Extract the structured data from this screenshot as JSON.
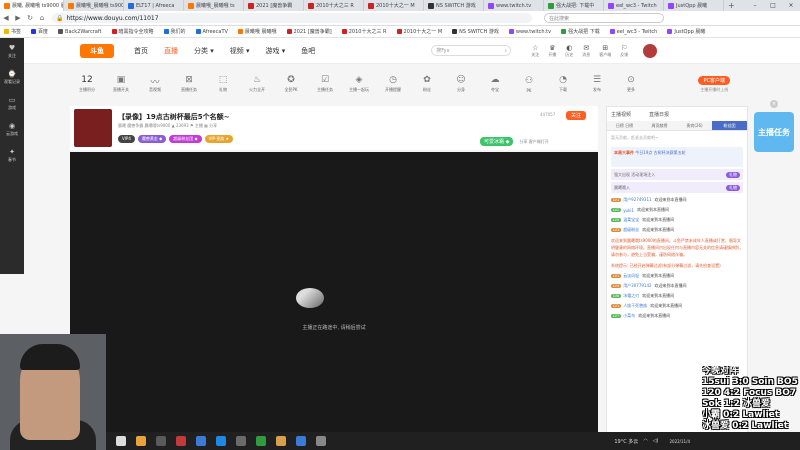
{
  "browser": {
    "tabs": [
      {
        "label": "晨曦, 晨曦哦 ts9000 晨曦哦 11017",
        "color": "#ff7700",
        "active": true
      },
      {
        "label": "晨曦哦_晨曦哦 ts9000",
        "color": "#ff7700"
      },
      {
        "label": "ELT17 | Afreeca",
        "color": "#1e6fd9"
      },
      {
        "label": "晨曦哦_晨曦哦 ts",
        "color": "#ff7700"
      },
      {
        "label": "2021 [魔兽争霸",
        "color": "#c22"
      },
      {
        "label": "2010十大之三 R",
        "color": "#c22"
      },
      {
        "label": "2010十大之一 M",
        "color": "#c22"
      },
      {
        "label": "NS SWITCH 游戏",
        "color": "#333"
      },
      {
        "label": "www.twitch.tv",
        "color": "#9146ff"
      },
      {
        "label": "强大战把: 下载中",
        "color": "#2e9d3b"
      },
      {
        "label": "eel_wc3 - Twitch",
        "color": "#9146ff"
      },
      {
        "label": "JustQpp 晨曦",
        "color": "#9146ff"
      }
    ],
    "new_tab": "+",
    "url": "https://www.douyu.com/11017",
    "search_placeholder": "在此搜索"
  },
  "bookmarks": [
    {
      "label": "书签",
      "color": "#f2b500"
    },
    {
      "label": "百度",
      "color": "#2932e1"
    },
    {
      "label": "Back2Warcraft",
      "color": "#555"
    },
    {
      "label": "暗黑指令全攻略",
      "color": "#c22"
    },
    {
      "label": "我们的",
      "color": "#1e6fd9"
    },
    {
      "label": "AfreecaTV",
      "color": "#1e6fd9"
    },
    {
      "label": "晨曦哦 晨曦哦",
      "color": "#ff7700"
    },
    {
      "label": "2021 [魔兽争霸]",
      "color": "#c22"
    },
    {
      "label": "2010十大之三 R",
      "color": "#c22"
    },
    {
      "label": "2010十大之一 M",
      "color": "#c22"
    },
    {
      "label": "NS SWITCH 游戏",
      "color": "#333"
    },
    {
      "label": "www.twitch.tv",
      "color": "#9146ff"
    },
    {
      "label": "强大战把 下载",
      "color": "#2e9d3b"
    },
    {
      "label": "eel_wc3 - Twitch",
      "color": "#9146ff"
    },
    {
      "label": "JustQpp 晨曦",
      "color": "#9146ff"
    }
  ],
  "sidebar": [
    {
      "icon": "♥",
      "label": "关注"
    },
    {
      "icon": "⌚",
      "label": "观看记录"
    },
    {
      "icon": "▭",
      "label": "游戏"
    },
    {
      "icon": "◉",
      "label": "云游戏"
    },
    {
      "icon": "✦",
      "label": "春节"
    }
  ],
  "site": {
    "logo": "斗鱼",
    "nav": [
      "首页",
      "直播",
      "分类 ▾",
      "视频 ▾",
      "游戏 ▾",
      "鱼吧"
    ],
    "search_placeholder": "搜Fyx",
    "header_icons": [
      {
        "icon": "☆",
        "label": "关注"
      },
      {
        "icon": "♛",
        "label": "开播"
      },
      {
        "icon": "◐",
        "label": "历史"
      },
      {
        "icon": "✉",
        "label": "消息"
      },
      {
        "icon": "⊞",
        "label": "客户端"
      },
      {
        "icon": "⚐",
        "label": "反馈"
      }
    ]
  },
  "toolbar": {
    "level": "12",
    "level_label": "主播积分",
    "items": [
      {
        "icon": "▣",
        "label": "直播开关"
      },
      {
        "icon": "〰",
        "label": "音视频"
      },
      {
        "icon": "⊠",
        "label": "直播任务"
      },
      {
        "icon": "⬚",
        "label": "礼物"
      },
      {
        "icon": "♨",
        "label": "火力全开"
      },
      {
        "icon": "✪",
        "label": "全民PK"
      },
      {
        "icon": "☑",
        "label": "主播任务"
      },
      {
        "icon": "◈",
        "label": "主播一起玩"
      },
      {
        "icon": "◷",
        "label": "开播提醒"
      },
      {
        "icon": "✿",
        "label": "粉丝"
      },
      {
        "icon": "☺",
        "label": "分身"
      },
      {
        "icon": "☁",
        "label": "夺宝"
      },
      {
        "icon": "⚇",
        "label": "PK"
      },
      {
        "icon": "◔",
        "label": "下载"
      },
      {
        "icon": "☰",
        "label": "发布"
      },
      {
        "icon": "⊙",
        "label": "更多"
      }
    ],
    "pc_button": "PC客户端",
    "pc_hint": "主播开播时上线"
  },
  "room": {
    "title": "【录像】19点古树杯最后5个名额~",
    "meta": "晨曦   魔兽争霸   晨曦哦ts9000   ▲ 23693   ⚑ 主播   ▦ 分享",
    "tags": [
      {
        "label": "VIP4",
        "color": "#444"
      },
      {
        "label": "魔兽黄金 ◆",
        "color": "#8a5cd6"
      },
      {
        "label": "超级粉丝团 ◆",
        "color": "#c23bd6"
      },
      {
        "label": "VIP·皇族 ★",
        "color": "#e6a52e"
      }
    ],
    "follow_count": "447057",
    "follow_label": "关注",
    "action_green": "可爱冰霜 ◆",
    "actions": "分享   客户端打开",
    "loading_text": "主播正在路途中, 请稍后尝试"
  },
  "chat": {
    "top_left": "主播视频",
    "top_right": "直播日报",
    "tabs": [
      "日榜 日榜",
      "周贡献榜",
      "贵宾(26)",
      "粉丝团"
    ],
    "rank_empty": "暂无贡献，赶紧去贡献吧~",
    "notice_title": "本周大事件",
    "notice_body": "今日19点 古树杯决赛第五轮",
    "gift1": "强大出现 活动现场注入",
    "gift1_btn": "礼物",
    "gift2": "晨曦哦入",
    "gift2_btn": "礼物",
    "messages": [
      {
        "lv": "LV1",
        "lvcolor": "#e08b3b",
        "nick": "用户92749311",
        "text": "欢迎来到本直播间"
      },
      {
        "lv": "LV2",
        "lvcolor": "#5cb85c",
        "nick": "yuki1",
        "text": "欢迎来到本直播间"
      },
      {
        "lv": "LV5",
        "lvcolor": "#5cb85c",
        "nick": "温柔宝宝",
        "text": "欢迎来到本直播间"
      },
      {
        "lv": "LV3",
        "lvcolor": "#e08b3b",
        "nick": "超级粉丝",
        "text": "欢迎来到本直播间"
      }
    ],
    "system": "欢迎来到晨曦哦ts9000的直播间。斗鱼严禁未成年人直播或打赏，倡导文明健康的网络环境。直播间内出现任何与直播内容无关的信息请谨慎辨别，请勿参与，避免上当受骗，谨防网络诈骗。",
    "system2": "系统提示: 已经开启弹幕过滤(有部分弹幕过滤，请先检查设置)",
    "messages2": [
      {
        "lv": "LV1",
        "lvcolor": "#e08b3b",
        "nick": "云淡风轻",
        "text": "欢迎来到本直播间"
      },
      {
        "lv": "LV4",
        "lvcolor": "#e08b3b",
        "nick": "用户30779142",
        "text": "欢迎来到本直播间"
      },
      {
        "lv": "LV8",
        "lvcolor": "#5cb85c",
        "nick": "冰霜之刃",
        "text": "欢迎来到本直播间"
      },
      {
        "lv": "LV1",
        "lvcolor": "#e08b3b",
        "nick": "人族干死兽族",
        "text": "欢迎来到本直播间"
      },
      {
        "lv": "LV7",
        "lvcolor": "#5cb85c",
        "nick": "小菜鸟",
        "text": "欢迎来到本直播间"
      }
    ]
  },
  "promo": "主播任务",
  "overlay_lines": [
    "今晚对阵",
    "15sui 3:0 Soin BO5",
    "120 4:2 Focus BO7",
    "Sok 1:2 冰兽爱",
    "小霸 0:2 Lawliet",
    "冰兽爱 0:2 Lawliet"
  ],
  "taskbar": {
    "icons": [
      "#ddd",
      "#e8a33a",
      "#5a5a5a",
      "#c4393b",
      "#3a7bd5",
      "#1e88e5",
      "#6b6b6b",
      "#2e9d3b",
      "#d8a04a",
      "#3c7bd5",
      "#888"
    ],
    "weather": "19°C 多云",
    "time": "",
    "date": "2022/11/4"
  }
}
